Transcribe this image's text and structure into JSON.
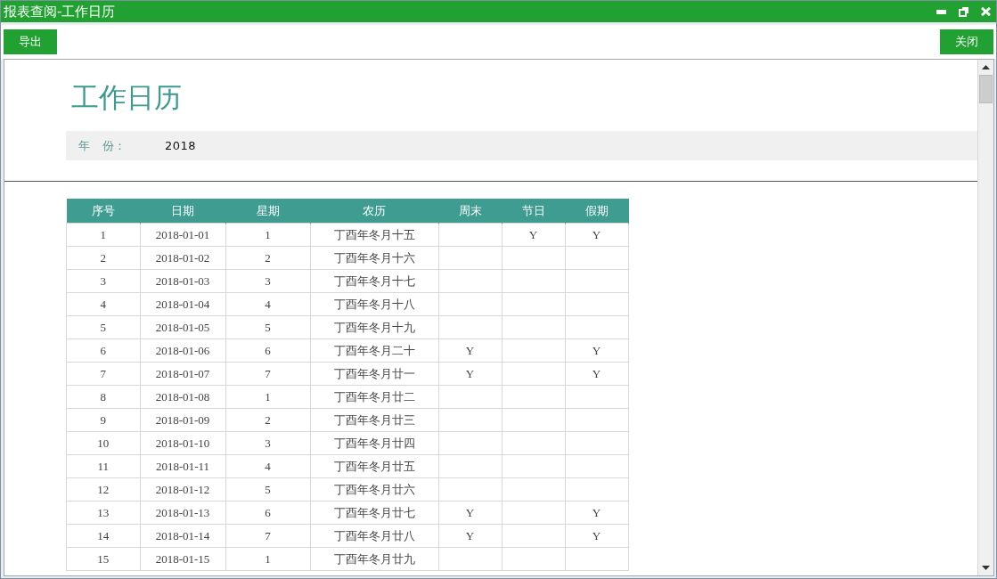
{
  "window": {
    "title": "报表查阅-工作日历"
  },
  "toolbar": {
    "export_button": "导出",
    "close_button": "关闭"
  },
  "report": {
    "title": "工作日历",
    "filter": {
      "label_1": "年",
      "label_2": "份：",
      "value": "2018"
    }
  },
  "table": {
    "columns": [
      "序号",
      "日期",
      "星期",
      "农历",
      "周末",
      "节日",
      "假期"
    ],
    "rows": [
      {
        "no": "1",
        "date": "2018-01-01",
        "weekday": "1",
        "lunar": "丁酉年冬月十五",
        "holiday": "Y",
        "vacation": "Y"
      },
      {
        "no": "2",
        "date": "2018-01-02",
        "weekday": "2",
        "lunar": "丁酉年冬月十六"
      },
      {
        "no": "3",
        "date": "2018-01-03",
        "weekday": "3",
        "lunar": "丁酉年冬月十七"
      },
      {
        "no": "4",
        "date": "2018-01-04",
        "weekday": "4",
        "lunar": "丁酉年冬月十八"
      },
      {
        "no": "5",
        "date": "2018-01-05",
        "weekday": "5",
        "lunar": "丁酉年冬月十九"
      },
      {
        "no": "6",
        "date": "2018-01-06",
        "weekday": "6",
        "lunar": "丁酉年冬月二十",
        "weekend": "Y",
        "vacation": "Y"
      },
      {
        "no": "7",
        "date": "2018-01-07",
        "weekday": "7",
        "lunar": "丁酉年冬月廿一",
        "weekend": "Y",
        "vacation": "Y"
      },
      {
        "no": "8",
        "date": "2018-01-08",
        "weekday": "1",
        "lunar": "丁酉年冬月廿二"
      },
      {
        "no": "9",
        "date": "2018-01-09",
        "weekday": "2",
        "lunar": "丁酉年冬月廿三"
      },
      {
        "no": "10",
        "date": "2018-01-10",
        "weekday": "3",
        "lunar": "丁酉年冬月廿四"
      },
      {
        "no": "11",
        "date": "2018-01-11",
        "weekday": "4",
        "lunar": "丁酉年冬月廿五"
      },
      {
        "no": "12",
        "date": "2018-01-12",
        "weekday": "5",
        "lunar": "丁酉年冬月廿六"
      },
      {
        "no": "13",
        "date": "2018-01-13",
        "weekday": "6",
        "lunar": "丁酉年冬月廿七",
        "weekend": "Y",
        "vacation": "Y"
      },
      {
        "no": "14",
        "date": "2018-01-14",
        "weekday": "7",
        "lunar": "丁酉年冬月廿八",
        "weekend": "Y",
        "vacation": "Y"
      },
      {
        "no": "15",
        "date": "2018-01-15",
        "weekday": "1",
        "lunar": "丁酉年冬月廿九"
      }
    ]
  }
}
